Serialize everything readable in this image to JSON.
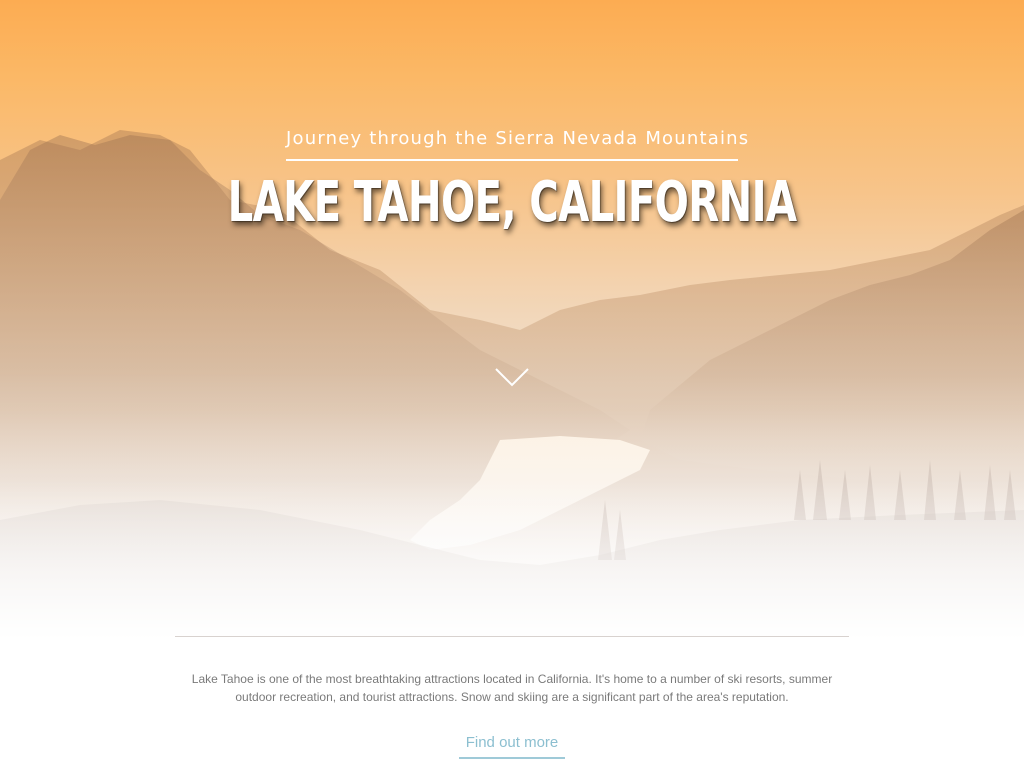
{
  "hero": {
    "subtitle": "Journey through the Sierra Nevada Mountains",
    "title": "LAKE TAHOE, CALIFORNIA",
    "scroll_icon": "chevron-down-icon",
    "background_image": "mountain-lake-landscape"
  },
  "content": {
    "description": "Lake Tahoe is one of the most breathtaking attractions located in California. It's home to a number of ski resorts, summer outdoor recreation, and tourist attractions. Snow and skiing are a significant part of the area's reputation.",
    "cta_label": "Find out more"
  },
  "colors": {
    "accent_orange": "#fcac52",
    "cta_blue": "#8cbfd0",
    "text_gray": "#7a7a7a"
  }
}
